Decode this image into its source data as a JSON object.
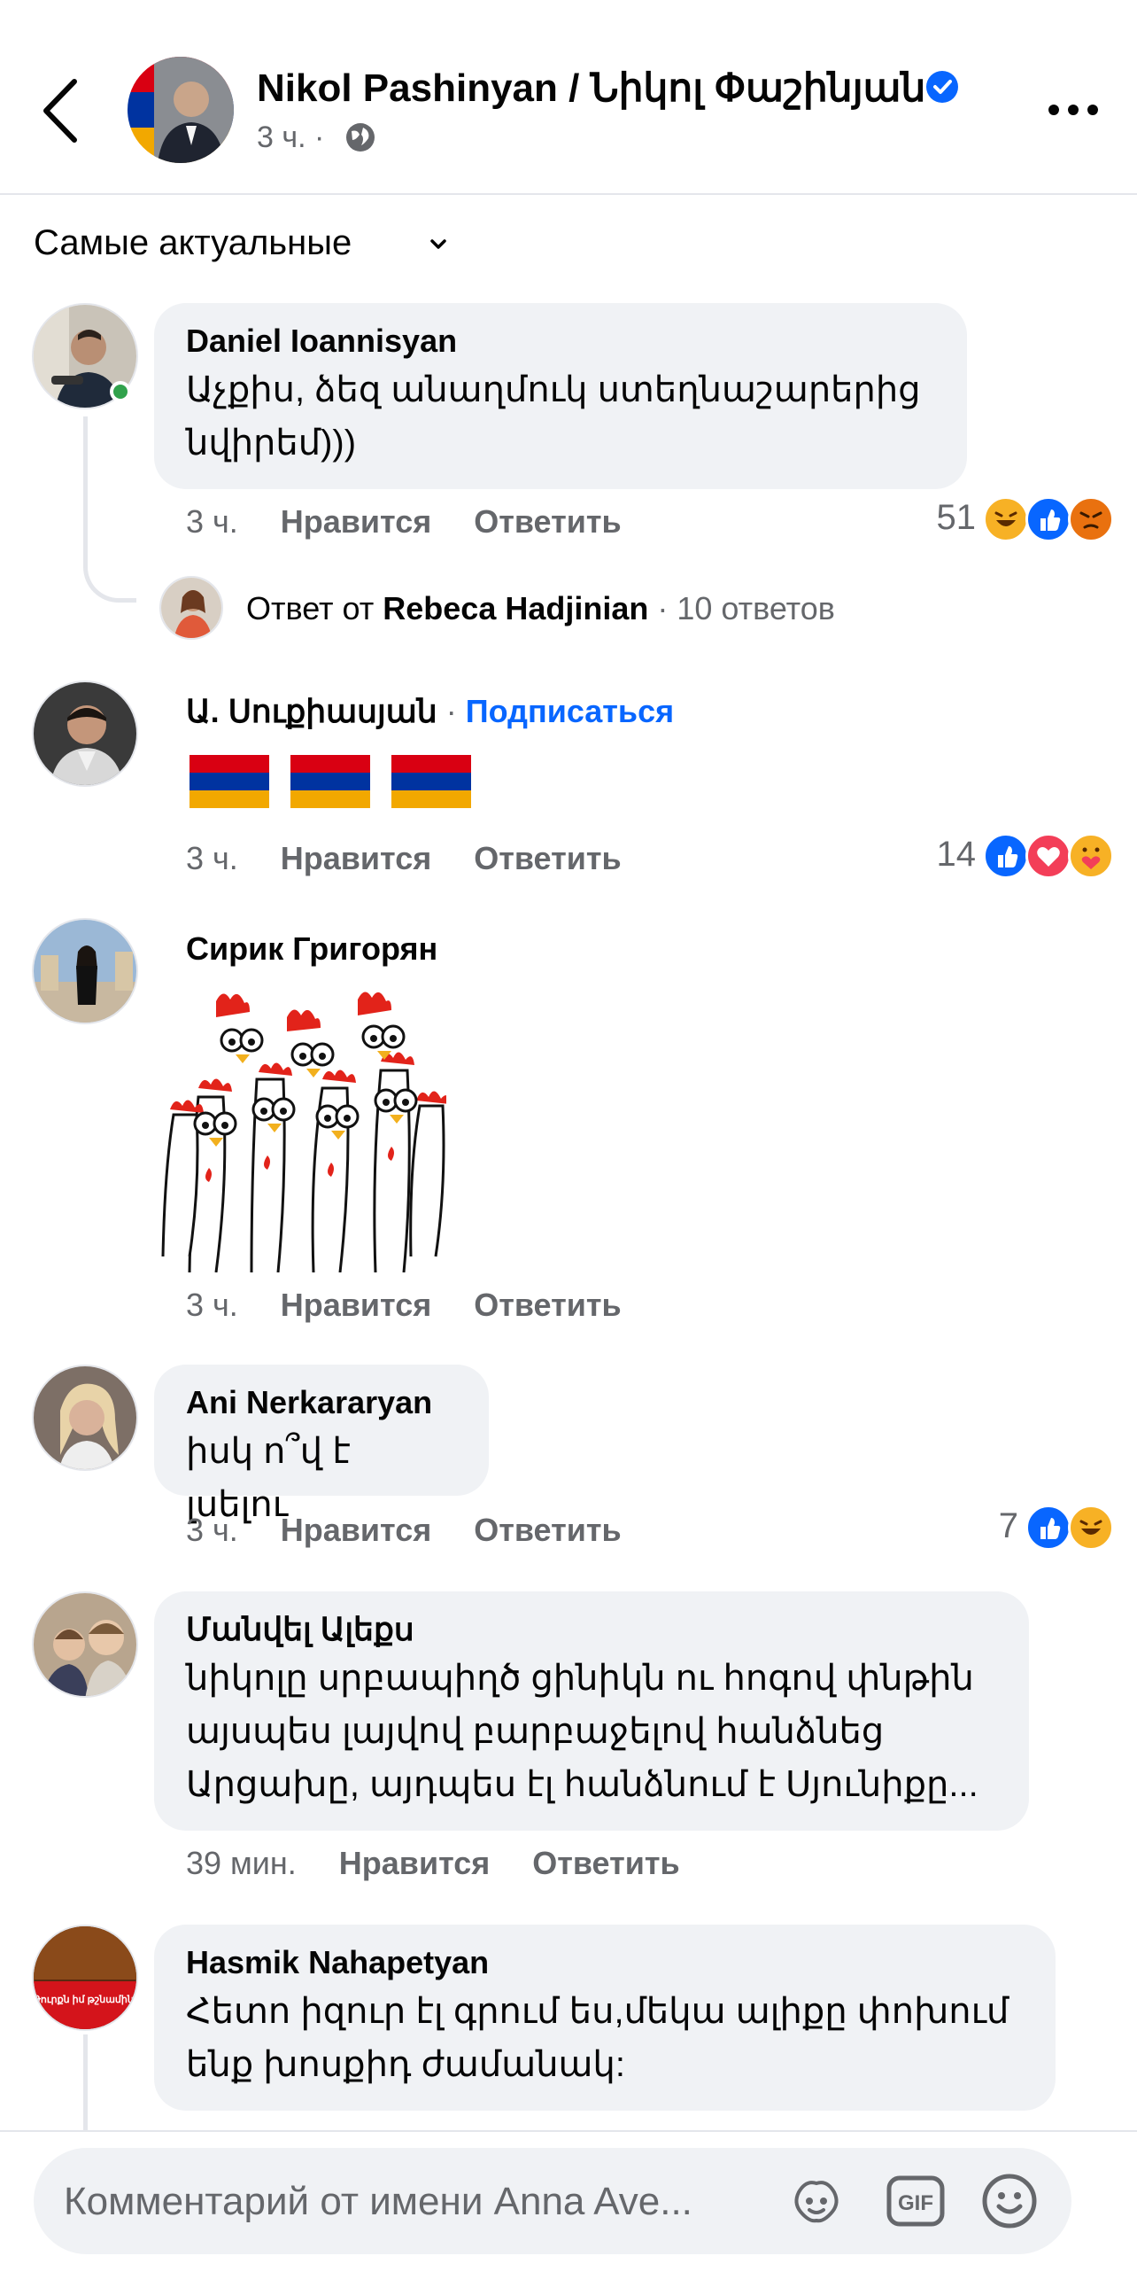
{
  "header": {
    "page_name": "Nikol Pashinyan / Նիկոլ Փաշինյան",
    "meta_time": "3 ч. ·"
  },
  "sort": {
    "label": "Самые актуальные"
  },
  "comments": [
    {
      "author": "Daniel Ioannisyan",
      "text": "Աչքիս, ձեզ անաղմուկ ստեղնաշարերից նվիրեմ)))",
      "time": "3 ч.",
      "like": "Нравится",
      "reply": "Ответить",
      "reactions_count": "51",
      "reply_prefix": "Ответ от",
      "reply_author": "Rebeca Hadjinian",
      "reply_count": "· 10 ответов"
    },
    {
      "author": "Ա. Սուքիասյան",
      "follow_sep": "·",
      "follow": "Подписаться",
      "text": "🇦🇲 🇦🇲 🇦🇲",
      "time": "3 ч.",
      "like": "Нравится",
      "reply": "Ответить",
      "reactions_count": "14"
    },
    {
      "author": "Сирик Григорян",
      "time": "3 ч.",
      "like": "Нравится",
      "reply": "Ответить"
    },
    {
      "author": "Ani Nerkararyan",
      "text": "իսկ ո՞վ է լսելու",
      "time": "3 ч.",
      "like": "Нравится",
      "reply": "Ответить",
      "reactions_count": "7"
    },
    {
      "author": "Մանվել Ալեքս",
      "text": "նիկոլը սրբապիղծ ցինիկն ու հոգով փնթին այսպես լայվով բարբաջելով հանձնեց Արցախը, այդպես էլ հանձնում է Սյունիքը...",
      "time": "39 мин.",
      "like": "Нравится",
      "reply": "Ответить"
    },
    {
      "author": "Hasmik Nahapetyan",
      "text": "Հետո իզուր էլ գրում ես,մեկա ալիքը փոխում ենք խոսքիդ ժամանակ:",
      "avatar_caption": "Թուրքն իմ թշնամին է"
    }
  ],
  "composer": {
    "placeholder": "Комментарий от имени Anna Ave..."
  },
  "icons": {
    "back": "chevron-left-icon",
    "verified": "verified-badge-icon",
    "globe": "globe-icon",
    "more": "more-options-icon",
    "sticker": "avatar-sticker-icon",
    "gif": "gif-icon",
    "emoji": "emoji-icon"
  },
  "colors": {
    "link": "#0866ff",
    "secondary_text": "#65676b",
    "bubble": "#f0f2f5",
    "online": "#31a24c"
  }
}
